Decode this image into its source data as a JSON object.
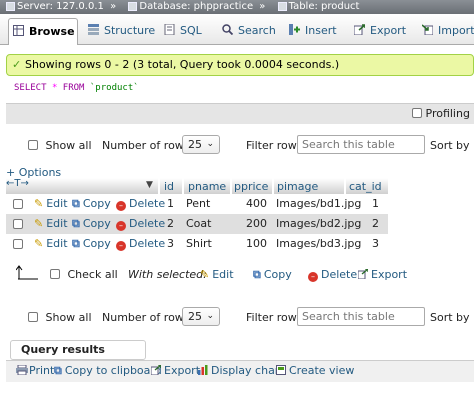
{
  "breadcrumb": {
    "server": "Server: 127.0.0.1",
    "database": "Database: phppractice",
    "table": "Table: product",
    "separator": "»"
  },
  "tabs": [
    {
      "label": "Browse",
      "icon": "browse-icon",
      "active": true
    },
    {
      "label": "Structure",
      "icon": "structure-icon"
    },
    {
      "label": "SQL",
      "icon": "sql-icon"
    },
    {
      "label": "Search",
      "icon": "search-icon"
    },
    {
      "label": "Insert",
      "icon": "insert-icon"
    },
    {
      "label": "Export",
      "icon": "export-icon"
    },
    {
      "label": "Import",
      "icon": "import-icon"
    }
  ],
  "notice": "Showing rows 0 - 2 (3 total, Query took 0.0004 seconds.)",
  "sql": {
    "select": "SELECT",
    "star": "*",
    "from": "FROM",
    "table": "`product`"
  },
  "profiling_label": "Profiling [",
  "nav_top": {
    "show_all": "Show all",
    "rows_label": "Number of rows:",
    "rows_value": "25",
    "filter_label": "Filter rows:",
    "filter_placeholder": "Search this table",
    "sort_label": "Sort by ke"
  },
  "options_link": "+ Options",
  "columns": [
    "id",
    "pname",
    "pprice",
    "pimage",
    "cat_id"
  ],
  "row_actions": {
    "edit": "Edit",
    "copy": "Copy",
    "delete": "Delete"
  },
  "rows": [
    {
      "id": "1",
      "pname": "Pent",
      "pprice": "400",
      "pimage": "Images/bd1.jpg",
      "cat_id": "1"
    },
    {
      "id": "2",
      "pname": "Coat",
      "pprice": "200",
      "pimage": "Images/bd2.jpg",
      "cat_id": "2"
    },
    {
      "id": "3",
      "pname": "Shirt",
      "pprice": "100",
      "pimage": "Images/bd3.jpg",
      "cat_id": "3"
    }
  ],
  "bulk": {
    "check_all": "Check all",
    "with_selected": "With selected:",
    "edit": "Edit",
    "copy": "Copy",
    "delete": "Delete",
    "export": "Export"
  },
  "nav_bottom": {
    "show_all": "Show all",
    "rows_label": "Number of rows:",
    "rows_value": "25",
    "filter_label": "Filter rows:",
    "filter_placeholder": "Search this table",
    "sort_label": "Sort by ke"
  },
  "ops": {
    "title": "Query results operations",
    "print": "Print",
    "copy_clipboard": "Copy to clipboard",
    "export": "Export",
    "display_chart": "Display chart",
    "create_view": "Create view"
  },
  "colors": {
    "accent_link": "#235a81",
    "notice_bg": "#ebf8a4",
    "notice_border": "#a2d246"
  }
}
